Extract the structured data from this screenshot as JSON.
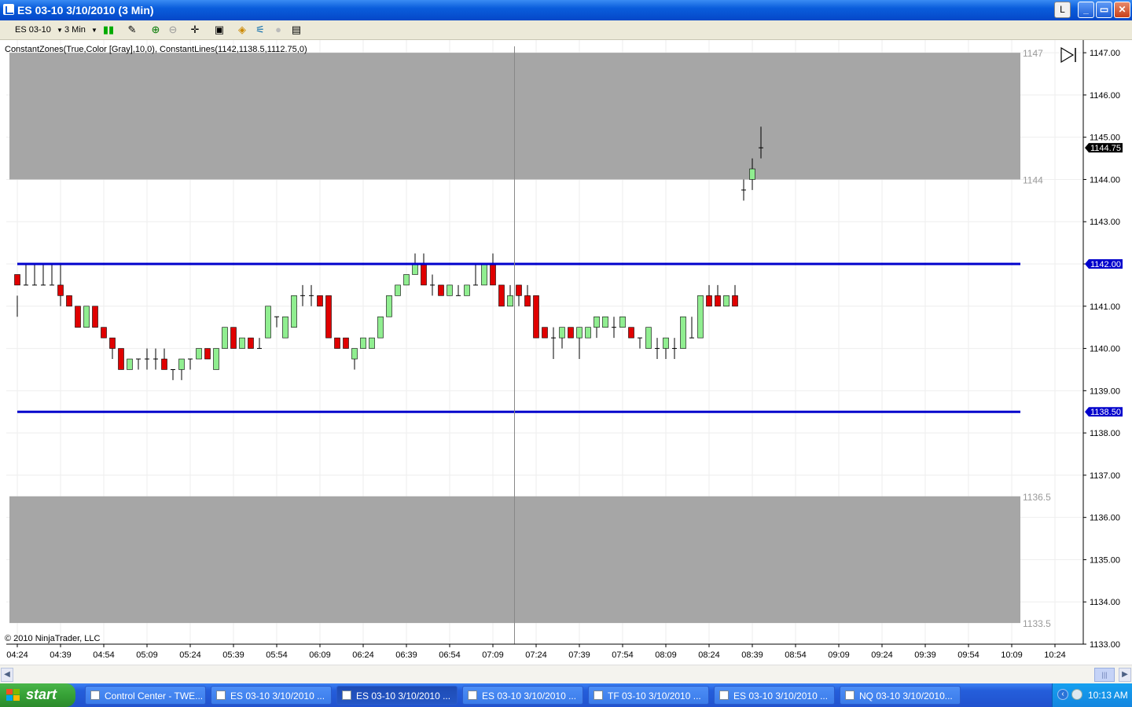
{
  "window": {
    "title": "ES 03-10  3/10/2010 (3 Min)",
    "buttons": [
      "L",
      "_",
      "▭",
      "✕"
    ]
  },
  "toolbar": {
    "instrument": "ES 03-10",
    "interval": "3 Min"
  },
  "indicator_label": "ConstantZones(True,Color [Gray],10,0), ConstantLines(1142,1138.5,1112.75,0)",
  "copyright": "© 2010 NinjaTrader, LLC",
  "taskbar": {
    "start": "start",
    "tasks": [
      {
        "label": "Control Center - TWE...",
        "active": false
      },
      {
        "label": "ES 03-10  3/10/2010 ...",
        "active": false
      },
      {
        "label": "ES 03-10  3/10/2010 ...",
        "active": true
      },
      {
        "label": "ES 03-10  3/10/2010 ...",
        "active": false
      },
      {
        "label": "TF 03-10  3/10/2010 ...",
        "active": false
      },
      {
        "label": "ES 03-10  3/10/2010 ...",
        "active": false
      },
      {
        "label": "NQ 03-10  3/10/2010...",
        "active": false
      }
    ],
    "clock": "10:13 AM"
  },
  "chart_data": {
    "type": "candlestick",
    "y_ticks": [
      "1147.00",
      "1146.00",
      "1145.00",
      "1144.00",
      "1143.00",
      "1142.00",
      "1141.00",
      "1140.00",
      "1139.00",
      "1138.00",
      "1137.00",
      "1136.00",
      "1135.00",
      "1134.00",
      "1133.00"
    ],
    "ylim": [
      1133,
      1147.3
    ],
    "x_ticks": [
      "04:24",
      "04:39",
      "04:54",
      "05:09",
      "05:24",
      "05:39",
      "05:54",
      "06:09",
      "06:24",
      "06:39",
      "06:54",
      "07:09",
      "07:24",
      "07:39",
      "07:54",
      "08:09",
      "08:24",
      "08:39",
      "08:54",
      "09:09",
      "09:24",
      "09:39",
      "09:54",
      "10:09",
      "10:24"
    ],
    "zones": [
      {
        "top": 1147,
        "bottom": 1144,
        "top_label": "1147",
        "bottom_label": "1144",
        "color": "#a6a6a6"
      },
      {
        "top": 1136.5,
        "bottom": 1133.5,
        "top_label": "1136.5",
        "bottom_label": "1133.5",
        "color": "#a6a6a6"
      }
    ],
    "lines": [
      {
        "value": 1142,
        "label": "1142.00",
        "color": "#0000cc"
      },
      {
        "value": 1138.5,
        "label": "1138.50",
        "color": "#0000cc"
      }
    ],
    "last_price": {
      "value": 1144.75,
      "label": "1144.75"
    },
    "cursor_time_index": 57.5,
    "up_color": "#90ee90",
    "down_color": "#e00000",
    "candles": [
      [
        1141.75,
        1141.25,
        1140.75,
        1141.5
      ],
      [
        1141.5,
        1142,
        1141.5,
        1141.5
      ],
      [
        1141.5,
        1142,
        1141.5,
        1141.5
      ],
      [
        1141.5,
        1142,
        1141.5,
        1141.5
      ],
      [
        1141.5,
        1142,
        1141.5,
        1141.5
      ],
      [
        1141.5,
        1142,
        1141,
        1141.25
      ],
      [
        1141.25,
        1141.25,
        1141,
        1141
      ],
      [
        1141,
        1141,
        1140.5,
        1140.5
      ],
      [
        1140.5,
        1141,
        1140.5,
        1141
      ],
      [
        1141,
        1141,
        1140.5,
        1140.5
      ],
      [
        1140.5,
        1140.5,
        1140.25,
        1140.25
      ],
      [
        1140.25,
        1140.25,
        1139.75,
        1140
      ],
      [
        1140,
        1140,
        1139.5,
        1139.5
      ],
      [
        1139.5,
        1139.75,
        1139.5,
        1139.75
      ],
      [
        1139.75,
        1139.75,
        1139.5,
        1139.75
      ],
      [
        1139.75,
        1140,
        1139.5,
        1139.75
      ],
      [
        1139.75,
        1140,
        1139.5,
        1139.75
      ],
      [
        1139.75,
        1140,
        1139.5,
        1139.5
      ],
      [
        1139.5,
        1139.5,
        1139.25,
        1139.5
      ],
      [
        1139.5,
        1139.75,
        1139.25,
        1139.75
      ],
      [
        1139.75,
        1139.75,
        1139.5,
        1139.75
      ],
      [
        1139.75,
        1140,
        1139.75,
        1140
      ],
      [
        1140,
        1140,
        1139.75,
        1139.75
      ],
      [
        1139.5,
        1140,
        1139.5,
        1140
      ],
      [
        1140,
        1140.5,
        1140,
        1140.5
      ],
      [
        1140.5,
        1140.5,
        1140,
        1140
      ],
      [
        1140,
        1140.25,
        1140,
        1140.25
      ],
      [
        1140.25,
        1140.25,
        1140,
        1140
      ],
      [
        1140,
        1140.25,
        1140,
        1140
      ],
      [
        1140.25,
        1141,
        1140.25,
        1141
      ],
      [
        1140.75,
        1140.75,
        1140.5,
        1140.75
      ],
      [
        1140.25,
        1140.75,
        1140.25,
        1140.75
      ],
      [
        1140.5,
        1141.25,
        1140.5,
        1141.25
      ],
      [
        1141.25,
        1141.5,
        1141,
        1141.25
      ],
      [
        1141.25,
        1141.5,
        1141,
        1141.25
      ],
      [
        1141.25,
        1141.25,
        1141,
        1141
      ],
      [
        1141.25,
        1141.25,
        1140.25,
        1140.25
      ],
      [
        1140.25,
        1140.25,
        1140,
        1140
      ],
      [
        1140.25,
        1140.25,
        1140,
        1140
      ],
      [
        1139.75,
        1140,
        1139.5,
        1140
      ],
      [
        1140,
        1140.25,
        1140,
        1140.25
      ],
      [
        1140,
        1140.25,
        1140,
        1140.25
      ],
      [
        1140.25,
        1140.75,
        1140.25,
        1140.75
      ],
      [
        1140.75,
        1141.25,
        1140.75,
        1141.25
      ],
      [
        1141.25,
        1141.5,
        1141.25,
        1141.5
      ],
      [
        1141.5,
        1141.75,
        1141.5,
        1141.75
      ],
      [
        1141.75,
        1142.25,
        1141.75,
        1142
      ],
      [
        1142,
        1142.25,
        1141.5,
        1141.5
      ],
      [
        1141.5,
        1141.75,
        1141.25,
        1141.5
      ],
      [
        1141.5,
        1141.5,
        1141.25,
        1141.25
      ],
      [
        1141.25,
        1141.5,
        1141.25,
        1141.5
      ],
      [
        1141.25,
        1141.5,
        1141.25,
        1141.25
      ],
      [
        1141.25,
        1141.5,
        1141.25,
        1141.5
      ],
      [
        1141.5,
        1142,
        1141.5,
        1141.5
      ],
      [
        1141.5,
        1142,
        1141.5,
        1142
      ],
      [
        1142,
        1142.25,
        1141.5,
        1141.5
      ],
      [
        1141.5,
        1141.5,
        1141,
        1141
      ],
      [
        1141,
        1141.5,
        1141,
        1141.25
      ],
      [
        1141.5,
        1141.5,
        1141,
        1141.25
      ],
      [
        1141.25,
        1141.5,
        1141,
        1141
      ],
      [
        1141.25,
        1141.25,
        1140.25,
        1140.25
      ],
      [
        1140.5,
        1140.5,
        1140.25,
        1140.25
      ],
      [
        1140.25,
        1140.5,
        1139.75,
        1140.25
      ],
      [
        1140.25,
        1140.5,
        1140,
        1140.5
      ],
      [
        1140.5,
        1140.5,
        1140.25,
        1140.25
      ],
      [
        1140.25,
        1140.5,
        1139.75,
        1140.5
      ],
      [
        1140.25,
        1140.5,
        1140.25,
        1140.5
      ],
      [
        1140.5,
        1140.75,
        1140.25,
        1140.75
      ],
      [
        1140.5,
        1140.75,
        1140.5,
        1140.75
      ],
      [
        1140.5,
        1140.75,
        1140.25,
        1140.5
      ],
      [
        1140.5,
        1140.75,
        1140.5,
        1140.75
      ],
      [
        1140.5,
        1140.5,
        1140.25,
        1140.25
      ],
      [
        1140.25,
        1140.25,
        1140,
        1140.25
      ],
      [
        1140,
        1140.5,
        1140,
        1140.5
      ],
      [
        1140,
        1140.25,
        1139.75,
        1140
      ],
      [
        1140,
        1140.25,
        1139.75,
        1140.25
      ],
      [
        1140,
        1140.25,
        1139.75,
        1140
      ],
      [
        1140,
        1140.75,
        1140,
        1140.75
      ],
      [
        1140.25,
        1140.75,
        1140.25,
        1140.25
      ],
      [
        1140.25,
        1141.25,
        1140.25,
        1141.25
      ],
      [
        1141.25,
        1141.5,
        1141,
        1141
      ],
      [
        1141.25,
        1141.5,
        1141,
        1141
      ],
      [
        1141,
        1141.25,
        1141,
        1141.25
      ],
      [
        1141.25,
        1141.5,
        1141.25,
        1141
      ]
    ]
  }
}
